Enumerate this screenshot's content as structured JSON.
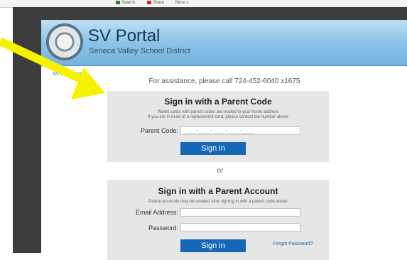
{
  "browser": {
    "bookmarks": [
      {
        "label": "Search"
      },
      {
        "label": "Share"
      },
      {
        "label": "More »"
      }
    ]
  },
  "header": {
    "title": "SV Portal",
    "subtitle": "Seneca Valley School District"
  },
  "nav": {
    "home_link": "SV Portal Home"
  },
  "assistance": "For assistance, please call 724-452-6040 x1675",
  "parent_code_panel": {
    "heading": "Sign in with a Parent Code",
    "note_line1": "Wallet cards with parent codes are mailed to your home address",
    "note_line2": "If you are in need of a replacement card, please contact the number above",
    "code_label": "Parent Code:",
    "code_placeholder": "____-____-____-____-____",
    "signin_label": "Sign in"
  },
  "divider": "or",
  "parent_account_panel": {
    "heading": "Sign in with a Parent Account",
    "note": "Parent accounts may be created after signing in with a parent code above",
    "email_label": "Email Address:",
    "password_label": "Password:",
    "signin_label": "Sign in",
    "forgot_label": "Forgot Password?"
  },
  "colors": {
    "frame": "#3d3d3d",
    "banner": "#8fc6e8",
    "button": "#1567b8",
    "panel": "#e6e6e6",
    "arrow": "#f5f200"
  }
}
